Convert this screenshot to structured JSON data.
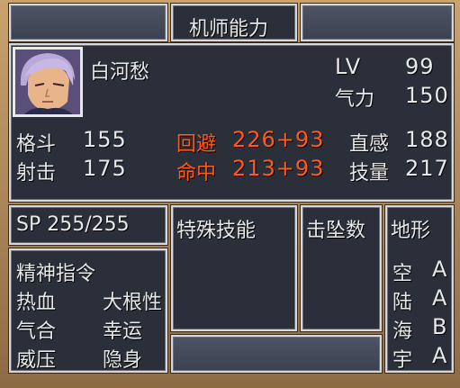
{
  "header": {
    "title": "机师能力"
  },
  "pilot": {
    "name": "白河愁",
    "lv_label": "LV",
    "lv_value": "99",
    "will_label": "气力",
    "will_value": "150"
  },
  "stats": {
    "melee_label": "格斗",
    "melee_value": "155",
    "shoot_label": "射击",
    "shoot_value": "175",
    "evade_label": "回避",
    "evade_value": "226+93",
    "hit_label": "命中",
    "hit_value": "213+93",
    "intuition_label": "直感",
    "intuition_value": "188",
    "skill_label": "技量",
    "skill_value": "217"
  },
  "sp": {
    "text": "SP 255/255"
  },
  "special_skills": {
    "title": "特殊技能"
  },
  "kills": {
    "title": "击坠数"
  },
  "terrain": {
    "title": "地形",
    "rows": [
      {
        "type": "空",
        "grade": "A"
      },
      {
        "type": "陆",
        "grade": "A"
      },
      {
        "type": "海",
        "grade": "B"
      },
      {
        "type": "宇",
        "grade": "A"
      }
    ]
  },
  "spirit": {
    "title": "精神指令",
    "commands": [
      "热血",
      "大根性",
      "气合",
      "幸运",
      "威压",
      "隐身"
    ]
  },
  "colors": {
    "highlight": "#ff5a1f",
    "panel": "#2a2f3a",
    "border": "#d8d8d8"
  }
}
